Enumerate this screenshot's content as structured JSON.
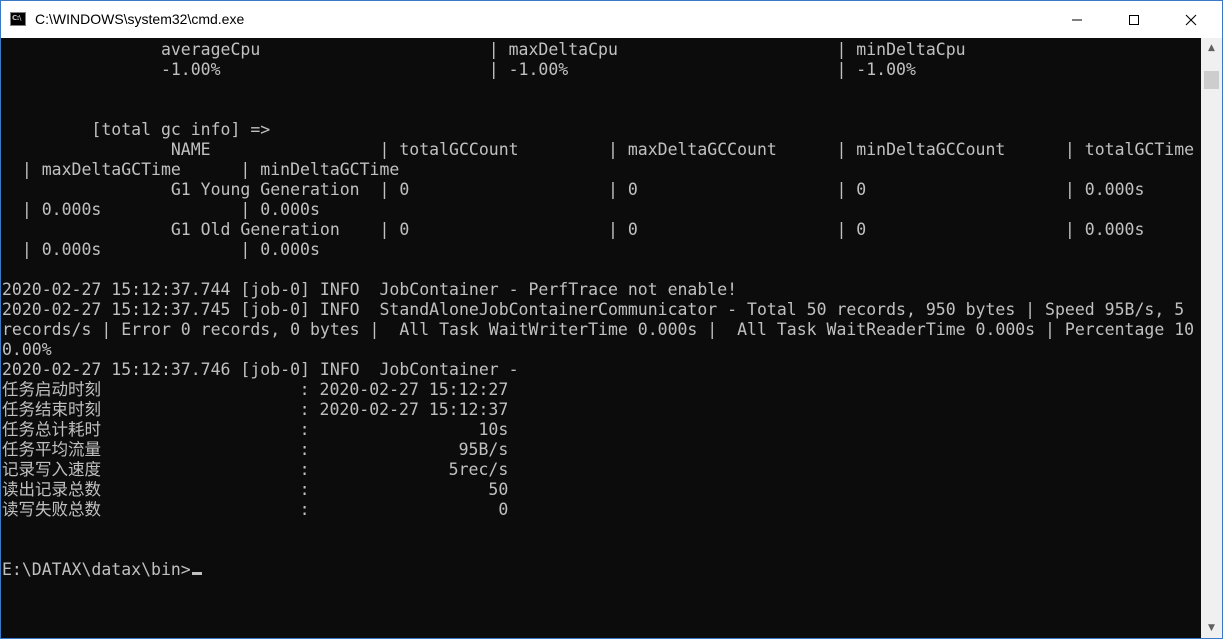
{
  "window": {
    "title": "C:\\WINDOWS\\system32\\cmd.exe",
    "icon_name": "cmd-icon",
    "icon_text": "C:\\",
    "controls": [
      "minimize-icon",
      "maximize-icon",
      "close-icon"
    ],
    "accent": "#3a78c8"
  },
  "console": {
    "background": "#0c0c0c",
    "foreground": "#c0c0c0",
    "lines": [
      "                averageCpu                       | maxDeltaCpu                      | minDeltaCpu",
      "                -1.00%                           | -1.00%                           | -1.00%",
      "",
      "",
      "         [total gc info] =>",
      "                 NAME                 | totalGCCount         | maxDeltaGCCount      | minDeltaGCCount      | totalGCTime",
      "  | maxDeltaGCTime      | minDeltaGCTime",
      "                 G1 Young Generation  | 0                    | 0                    | 0                    | 0.000s",
      "  | 0.000s              | 0.000s",
      "                 G1 Old Generation    | 0                    | 0                    | 0                    | 0.000s",
      "  | 0.000s              | 0.000s",
      "",
      "2020-02-27 15:12:37.744 [job-0] INFO  JobContainer - PerfTrace not enable!",
      "2020-02-27 15:12:37.745 [job-0] INFO  StandAloneJobContainerCommunicator - Total 50 records, 950 bytes | Speed 95B/s, 5",
      "records/s | Error 0 records, 0 bytes |  All Task WaitWriterTime 0.000s |  All Task WaitReaderTime 0.000s | Percentage 10",
      "0.00%",
      "2020-02-27 15:12:37.746 [job-0] INFO  JobContainer -",
      "任务启动时刻                    : 2020-02-27 15:12:27",
      "任务结束时刻                    : 2020-02-27 15:12:37",
      "任务总计耗时                    :                 10s",
      "任务平均流量                    :               95B/s",
      "记录写入速度                    :              5rec/s",
      "读出记录总数                    :                  50",
      "读写失败总数                    :                   0",
      "",
      "",
      "E:\\DATAX\\datax\\bin>"
    ]
  },
  "scrollbar": {
    "up_icon": "scroll-up-arrow-icon",
    "down_icon": "scroll-down-arrow-icon"
  }
}
